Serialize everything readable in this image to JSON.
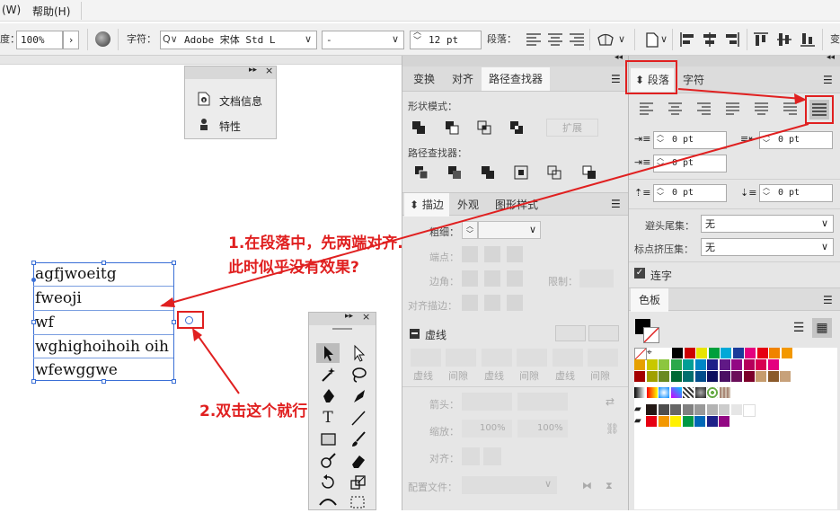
{
  "menu": {
    "items": [
      "(W)",
      "帮助(H)"
    ]
  },
  "control": {
    "zoom_label": "度：",
    "zoom_value": "100%",
    "char_label": "字符：",
    "font_name": "Adobe 宋体 Std L",
    "font_style": "-",
    "size_value": "12 pt",
    "para_label": "段落："
  },
  "doc_panel": {
    "items": [
      "文档信息",
      "特性"
    ]
  },
  "canvas": {
    "lines": [
      "agfjwoeitg",
      "fweoji",
      "wf",
      "wghighoihoih oih",
      "wfewggwe"
    ]
  },
  "pathfinder": {
    "tabs": [
      "变换",
      "对齐",
      "路径查找器"
    ],
    "shape_modes_label": "形状模式：",
    "expand_button": "扩展",
    "pathfinders_label": "路径查找器："
  },
  "stroke": {
    "tabs": [
      "描边",
      "外观",
      "图形样式"
    ],
    "weight_label": "粗细：",
    "cap_label": "端点：",
    "corner_label": "边角：",
    "limit_label": "限制：",
    "align_label": "对齐描边：",
    "dashed_label": "虚线",
    "dash_labels": [
      "虚线",
      "间隙",
      "虚线",
      "间隙",
      "虚线",
      "间隙"
    ],
    "arrow_label": "箭头：",
    "scale_label": "缩放：",
    "scale_values": [
      "100%",
      "100%"
    ],
    "align2_label": "对齐：",
    "profile_label": "配置文件："
  },
  "paragraph": {
    "tabs": [
      "段落",
      "字符"
    ],
    "left_indent": "0 pt",
    "right_indent": "0 pt",
    "first_indent": "0 pt",
    "space_before": "0 pt",
    "space_after": "0 pt",
    "kinsoku_label": "避头尾集：",
    "kinsoku_value": "无",
    "mojikumi_label": "标点挤压集：",
    "mojikumi_value": "无",
    "hyphen_label": "连字"
  },
  "swatches": {
    "tab": "色板",
    "row1": [
      "#000000",
      "#cc0000",
      "#e8e400",
      "#00a03c",
      "#00a9d8",
      "#1b3b9a",
      "#e4007f",
      "#e60012",
      "#f08300",
      "#f39800"
    ],
    "row2": [
      "#e6a000",
      "#c8c800",
      "#8cc63f",
      "#2aa84a",
      "#009e96",
      "#0086c6",
      "#1d2088",
      "#601986",
      "#920783",
      "#b5005b",
      "#d70051",
      "#e4007f"
    ],
    "row3": [
      "#a40000",
      "#a0a000",
      "#6a8a22",
      "#006934",
      "#006e6e",
      "#004c8c",
      "#0d0d5e",
      "#4b0f63",
      "#6b0f5a",
      "#7c002a",
      "#c69c6d",
      "#8b5a2b",
      "#c7a17a"
    ],
    "row4": [
      "#231815",
      "#4d4d4d",
      "#666666",
      "#808080",
      "#999999",
      "#b3b3b3",
      "#cccccc",
      "#e6e6e6",
      "#ffffff"
    ],
    "row5": [
      "#e60012",
      "#f39800",
      "#fff100",
      "#009944",
      "#0068b7",
      "#1d2088",
      "#920783"
    ]
  },
  "annotations": {
    "note1_line1": "1.在段落中，先两端对齐.",
    "note1_line2": "此时似乎没有效果?",
    "note2": "2.双击这个就行"
  },
  "colors": {
    "accent_red": "#e02020",
    "selection_blue": "#3a6fd6"
  }
}
